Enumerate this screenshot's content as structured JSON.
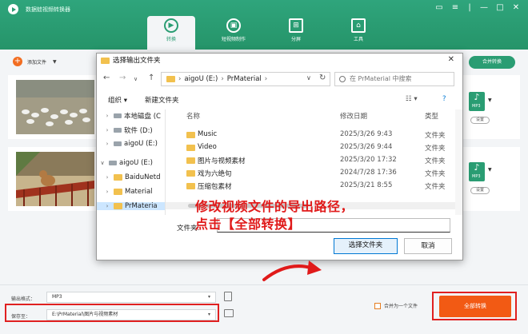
{
  "app": {
    "title": "数据蛙视频转换器",
    "tabs": [
      {
        "label": "转换",
        "icon": "convert-icon",
        "active": true
      },
      {
        "label": "短视频制作",
        "icon": "video-make-icon",
        "active": false
      },
      {
        "label": "分屏",
        "icon": "split-screen-icon",
        "active": false
      },
      {
        "label": "工具",
        "icon": "toolbox-icon",
        "active": false
      }
    ],
    "accent": "#2a9d73",
    "add_file": "添加文件",
    "merge_top": "合并转换",
    "format_badge": "MP3",
    "settings_label": "设置",
    "output_format_label": "输出格式：",
    "output_format_value": "MP3",
    "save_to_label": "保存至：",
    "save_to_value": "E:\\PrMaterial\\图片与视频素材",
    "merge_checkbox": "合并为一个文件",
    "convert_all": "全部转换",
    "convert_color": "#f25a14"
  },
  "dialog": {
    "title": "选择输出文件夹",
    "path": [
      "aigoU (E:)",
      "PrMaterial"
    ],
    "search_placeholder": "在 PrMaterial 中搜索",
    "organize": "组织",
    "new_folder": "新建文件夹",
    "tree": [
      {
        "label": "本地磁盘 (C",
        "type": "drive",
        "expanded": false
      },
      {
        "label": "软件 (D:)",
        "type": "drive",
        "expanded": false
      },
      {
        "label": "aigoU (E:)",
        "type": "drive",
        "expanded": false
      },
      {
        "label": "aigoU (E:)",
        "type": "drive",
        "expanded": true
      },
      {
        "label": "BaiduNetd",
        "type": "folder",
        "expanded": false
      },
      {
        "label": "Material",
        "type": "folder",
        "expanded": false
      },
      {
        "label": "PrMateria",
        "type": "folder",
        "selected": true
      }
    ],
    "columns": {
      "name": "名称",
      "date": "修改日期",
      "type": "类型"
    },
    "files": [
      {
        "name": "Music",
        "date": "2025/3/26 9:43",
        "type": "文件夹"
      },
      {
        "name": "Video",
        "date": "2025/3/26 9:44",
        "type": "文件夹"
      },
      {
        "name": "图片与视频素材",
        "date": "2025/3/20 17:32",
        "type": "文件夹"
      },
      {
        "name": "戏为六绝句",
        "date": "2024/7/28 17:36",
        "type": "文件夹"
      },
      {
        "name": "压缩包素材",
        "date": "2025/3/21 8:55",
        "type": "文件夹"
      }
    ],
    "folder_label": "文件夹:",
    "select_button": "选择文件夹",
    "cancel_button": "取消"
  },
  "annotation": {
    "line1": "修改视频文件的导出路径，",
    "line2": "点击【全部转换】",
    "color": "#e01a1a"
  }
}
